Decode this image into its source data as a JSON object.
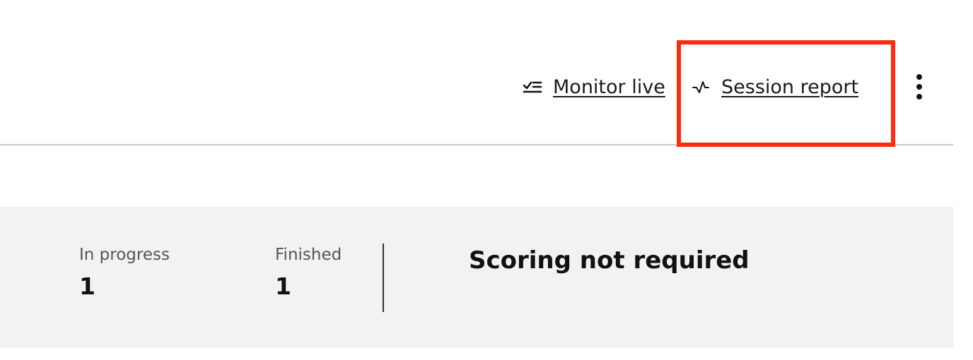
{
  "toolbar": {
    "actions": [
      {
        "label": "Monitor live",
        "icon": "checklist-icon"
      },
      {
        "label": "Session report",
        "icon": "activity-pulse-icon"
      }
    ],
    "more_menu_icon": "more-vertical-icon",
    "highlight_color": "#ff2a0f"
  },
  "stats": {
    "in_progress": {
      "label": "In progress",
      "value": "1"
    },
    "finished": {
      "label": "Finished",
      "value": "1"
    },
    "scoring_status": "Scoring not required"
  },
  "colors": {
    "panel_background": "#f2f2f2",
    "divider": "#c8c8c8",
    "text": "#1a1a1a"
  }
}
